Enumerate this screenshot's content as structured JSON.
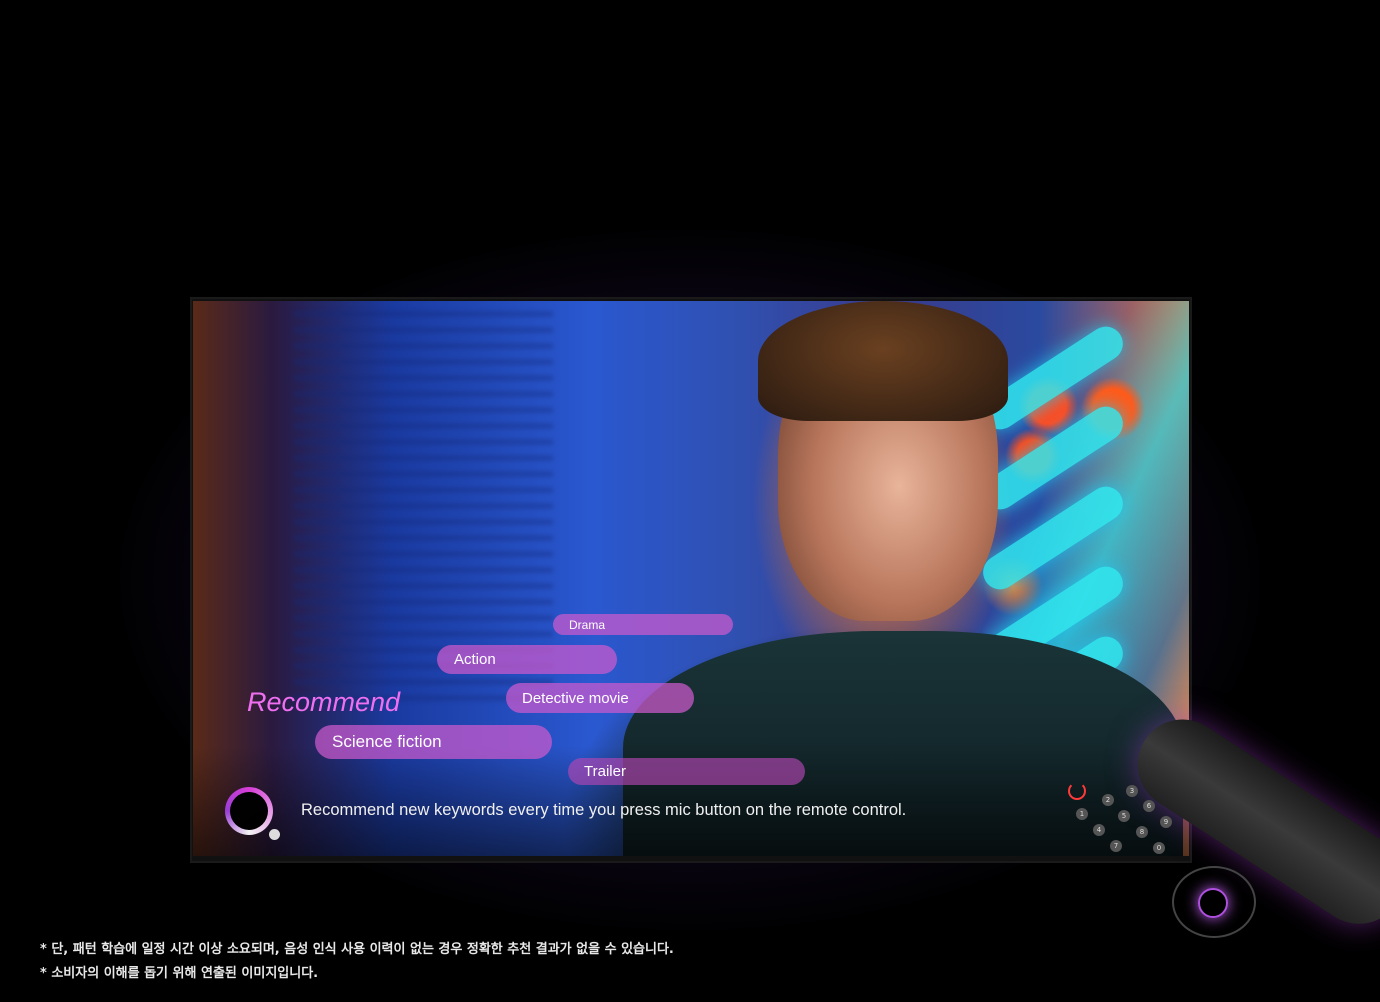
{
  "screen": {
    "title": "Recommend",
    "keywords": [
      "Drama",
      "Action",
      "Detective movie",
      "Science fiction",
      "Trailer"
    ],
    "hint": "Recommend new keywords every time you press mic button on the remote control.",
    "accent_color": "#ef6ff0",
    "pill_color": "#cd5acd",
    "voice_icon": "voice-assistant-ring-icon"
  },
  "remote": {
    "buttons": [
      "1",
      "2",
      "3",
      "4",
      "5",
      "6",
      "7",
      "8",
      "9",
      "0"
    ],
    "icons": [
      "power-icon",
      "mic-icon"
    ]
  },
  "notes": [
    "* 단, 패턴 학습에 일정 시간 이상 소요되며, 음성 인식 사용 이력이 없는 경우 정확한 추천 결과가 없을 수 있습니다.",
    "* 소비자의 이해를 돕기 위해 연출된 이미지입니다."
  ]
}
